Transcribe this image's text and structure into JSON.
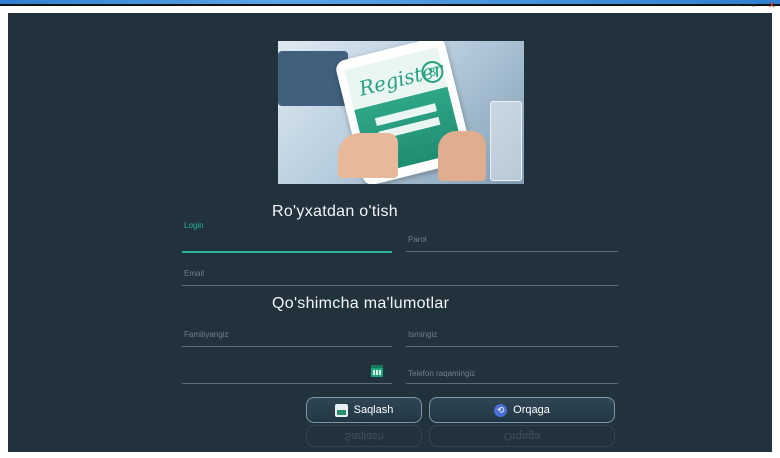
{
  "window": {
    "controls": {
      "minimize": "–",
      "maximize": "▫",
      "close": "✕"
    }
  },
  "hero": {
    "image_text": "Register"
  },
  "form": {
    "title": "Ro'yxatdan o'tish",
    "login_label": "Login",
    "parol_label": "Parol",
    "email_label": "Email",
    "extra_title": "Qo'shimcha ma'lumotlar",
    "familiya_label": "Familiyangiz",
    "ismingiz_label": "Ismingiz",
    "telefon_label": "Telefon raqamingiz"
  },
  "buttons": {
    "save_label": "Saqlash",
    "back_label": "Orqaga"
  },
  "colors": {
    "background": "#22323d",
    "accent": "#2bb59a",
    "button_border": "#7f97a6"
  },
  "icons": {
    "save": "save-icon",
    "back": "back-arrow-icon",
    "calendar": "calendar-icon"
  }
}
